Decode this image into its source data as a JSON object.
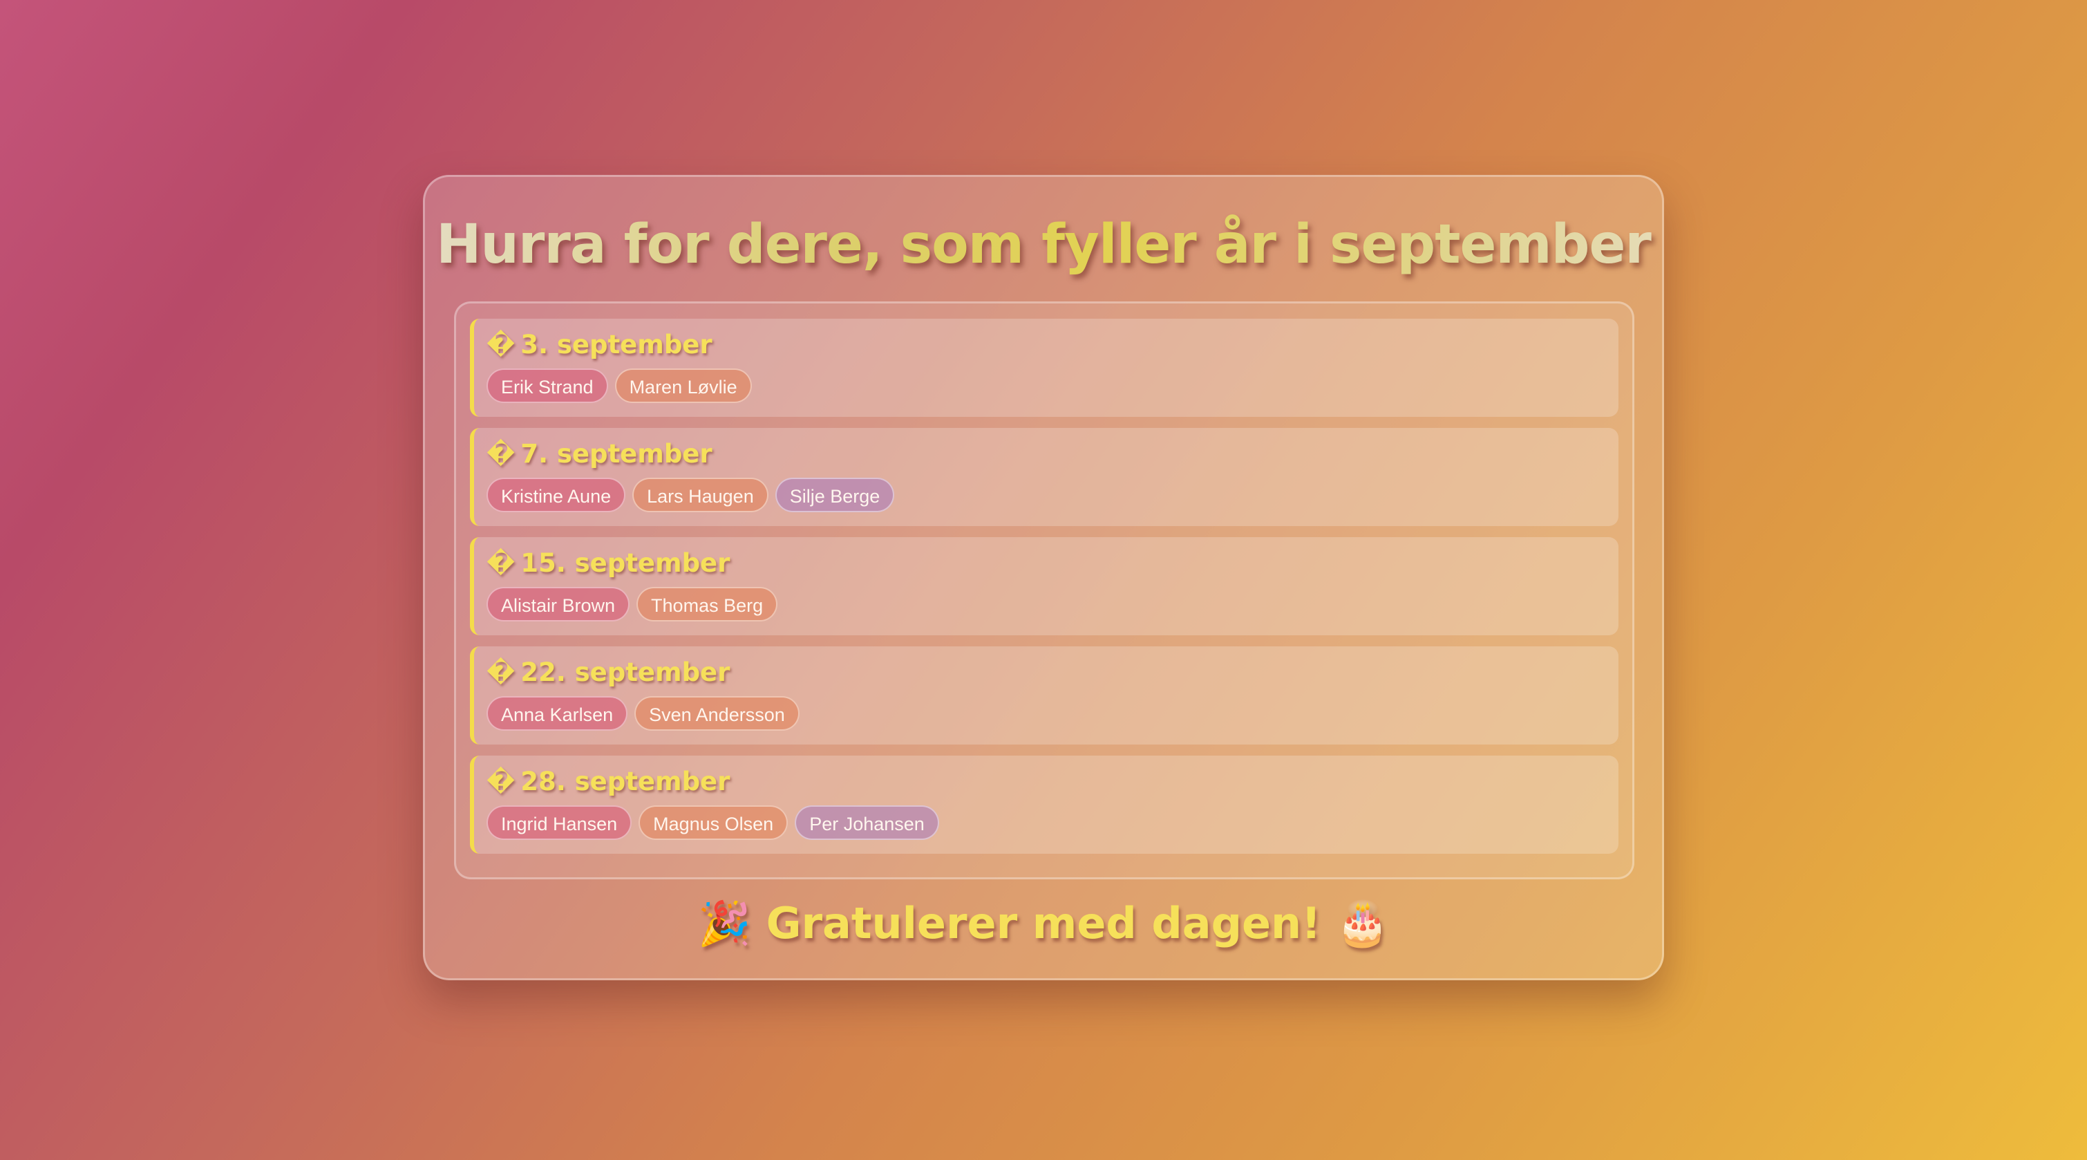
{
  "page": {
    "title": "Hurra for dere, som fyller år i september",
    "footer": "🎉 Gratulerer med dagen! 🎂"
  },
  "birthdays": [
    {
      "icon": "�",
      "date": "3. september",
      "names": [
        "Erik Strand",
        "Maren Løvlie"
      ]
    },
    {
      "icon": "�",
      "date": "7. september",
      "names": [
        "Kristine Aune",
        "Lars Haugen",
        "Silje Berge"
      ]
    },
    {
      "icon": "�",
      "date": "15. september",
      "names": [
        "Alistair Brown",
        "Thomas Berg"
      ]
    },
    {
      "icon": "�",
      "date": "22. september",
      "names": [
        "Anna Karlsen",
        "Sven Andersson"
      ]
    },
    {
      "icon": "�",
      "date": "28. september",
      "names": [
        "Ingrid Hansen",
        "Magnus Olsen",
        "Per Johansen"
      ]
    }
  ],
  "colors": {
    "accent": "#f4dc4a",
    "chip_pink": "#d64e70",
    "chip_orange": "#e27e52",
    "chip_purple": "#a676bc"
  }
}
